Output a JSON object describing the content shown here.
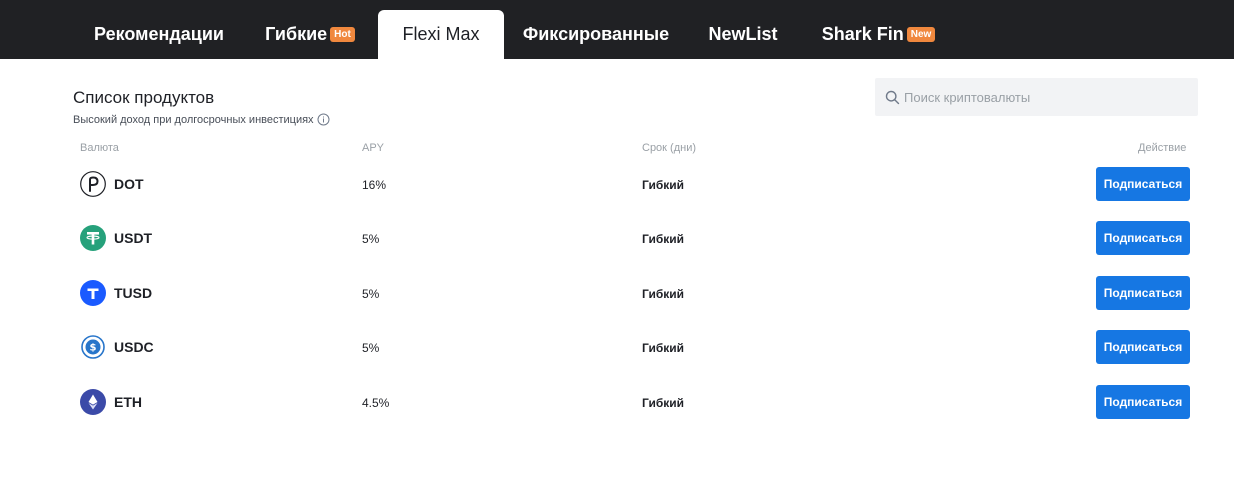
{
  "tabs": [
    {
      "label": "Рекомендации",
      "badge": ""
    },
    {
      "label": "Гибкие",
      "badge": "Hot"
    },
    {
      "label": "Flexi Max",
      "badge": ""
    },
    {
      "label": "Фиксированные",
      "badge": ""
    },
    {
      "label": "NewList",
      "badge": ""
    },
    {
      "label": "Shark Fin",
      "badge": "New"
    }
  ],
  "active_tab": "Flexi Max",
  "section": {
    "title": "Список продуктов",
    "subtitle": "Высокий доход при долгосрочных инвестициях"
  },
  "search": {
    "placeholder": "Поиск криптовалюты",
    "value": ""
  },
  "table": {
    "headers": {
      "currency": "Валюта",
      "apy": "APY",
      "term": "Срок (дни)",
      "action": "Действие"
    },
    "rows": [
      {
        "coin": "DOT",
        "icon": "polkadot-icon",
        "apy": "16%",
        "term": "Гибкий",
        "action": "Подписаться"
      },
      {
        "coin": "USDT",
        "icon": "tether-icon",
        "apy": "5%",
        "term": "Гибкий",
        "action": "Подписаться"
      },
      {
        "coin": "TUSD",
        "icon": "trueusd-icon",
        "apy": "5%",
        "term": "Гибкий",
        "action": "Подписаться"
      },
      {
        "coin": "USDC",
        "icon": "usdc-icon",
        "apy": "5%",
        "term": "Гибкий",
        "action": "Подписаться"
      },
      {
        "coin": "ETH",
        "icon": "ethereum-icon",
        "apy": "4.5%",
        "term": "Гибкий",
        "action": "Подписаться"
      }
    ]
  },
  "colors": {
    "topbar": "#202124",
    "badge": "#f0883e",
    "button": "#1677e3",
    "usdt": "#26a17b",
    "tusd": "#1a5aff",
    "usdc": "#2775ca",
    "eth": "#3b4aa8"
  }
}
